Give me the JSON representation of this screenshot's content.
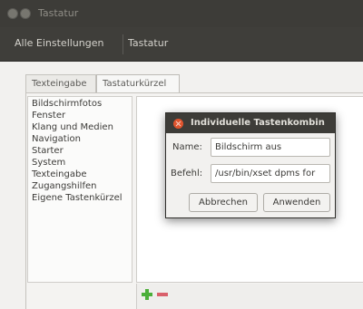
{
  "window": {
    "title": "Tastatur"
  },
  "toolbar": {
    "all_settings": "Alle Einstellungen",
    "current": "Tastatur"
  },
  "tabs": [
    {
      "label": "Texteingabe"
    },
    {
      "label": "Tastaturkürzel"
    }
  ],
  "categories": [
    {
      "label": "Bildschirmfotos"
    },
    {
      "label": "Fenster"
    },
    {
      "label": "Klang und Medien"
    },
    {
      "label": "Navigation"
    },
    {
      "label": "Starter"
    },
    {
      "label": "System"
    },
    {
      "label": "Texteingabe"
    },
    {
      "label": "Zugangshilfen"
    },
    {
      "label": "Eigene Tastenkürzel"
    }
  ],
  "dialog": {
    "title": "Individuelle Tastenkombin",
    "name_label": "Name:",
    "name_value": "Bildschirm aus",
    "command_label": "Befehl:",
    "command_value": "/usr/bin/xset dpms for",
    "cancel_label": "Abbrechen",
    "apply_label": "Anwenden"
  },
  "icons": {
    "add": "plus-icon",
    "remove": "minus-icon",
    "close": "close-icon"
  },
  "colors": {
    "titlebar": "#3d3c38",
    "close": "#e0542e",
    "add": "#4caf3a",
    "remove": "#d9606b"
  }
}
